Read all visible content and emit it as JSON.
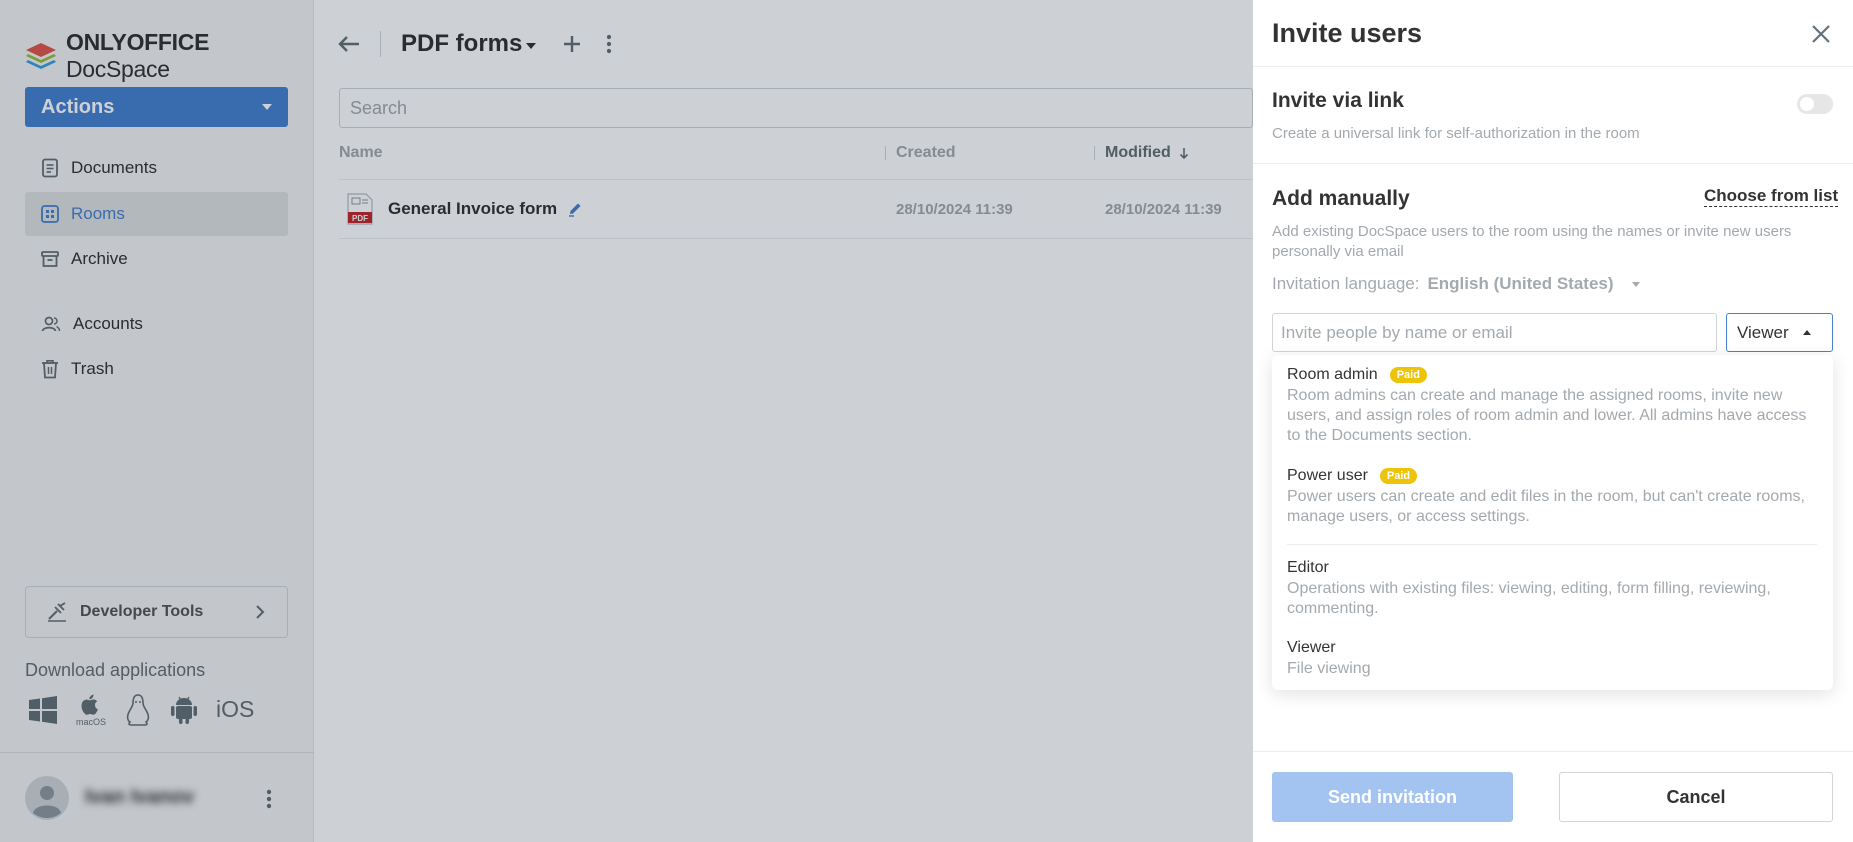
{
  "app": {
    "logo_bold": "ONLYOFFICE",
    "logo_regular": " DocSpace"
  },
  "sidebar": {
    "actions_label": "Actions",
    "items": [
      {
        "label": "Documents",
        "icon": "document-icon"
      },
      {
        "label": "Rooms",
        "icon": "rooms-icon",
        "active": true
      },
      {
        "label": "Archive",
        "icon": "archive-icon"
      },
      {
        "label": "Accounts",
        "icon": "accounts-icon"
      },
      {
        "label": "Trash",
        "icon": "trash-icon"
      }
    ],
    "developer_tools_label": "Developer Tools",
    "download_label": "Download applications",
    "apps": [
      "windows-icon",
      "macos-icon",
      "linux-icon",
      "android-icon",
      "iOS"
    ],
    "macos_caption": "macOS",
    "ios_label": "iOS",
    "user_name": "Ivan Ivanov"
  },
  "main": {
    "title": "PDF forms",
    "search_placeholder": "Search",
    "columns": {
      "name": "Name",
      "created": "Created",
      "modified": "Modified"
    },
    "files": [
      {
        "name": "General Invoice form",
        "created": "28/10/2024 11:39",
        "modified": "28/10/2024 11:39",
        "type_label": "PDF"
      }
    ]
  },
  "panel": {
    "title": "Invite users",
    "invite_link": {
      "title": "Invite via link",
      "desc": "Create a universal link for self-authorization in the room",
      "enabled": false
    },
    "add_manually": {
      "title": "Add manually",
      "choose_label": "Choose from list",
      "desc": "Add existing DocSpace users to the room using the names or invite new users personally via email",
      "language_label": "Invitation language:",
      "language_value": "English (United States)",
      "input_placeholder": "Invite people by name or email",
      "selected_role": "Viewer"
    },
    "roles": [
      {
        "title": "Room admin",
        "badge": "Paid",
        "desc": "Room admins can create and manage the assigned rooms, invite new users, and assign roles of room admin and lower. All admins have access to the Documents section."
      },
      {
        "title": "Power user",
        "badge": "Paid",
        "desc": "Power users can create and edit files in the room, but can't create rooms, manage users, or access settings."
      },
      {
        "title": "Editor",
        "desc": "Operations with existing files: viewing, editing, form filling, reviewing, commenting."
      },
      {
        "title": "Viewer",
        "desc": "File viewing"
      }
    ],
    "send_label": "Send invitation",
    "cancel_label": "Cancel"
  },
  "colors": {
    "accent": "#4781d1",
    "paid_badge": "#edc409",
    "send_disabled": "#a3c4f0"
  }
}
